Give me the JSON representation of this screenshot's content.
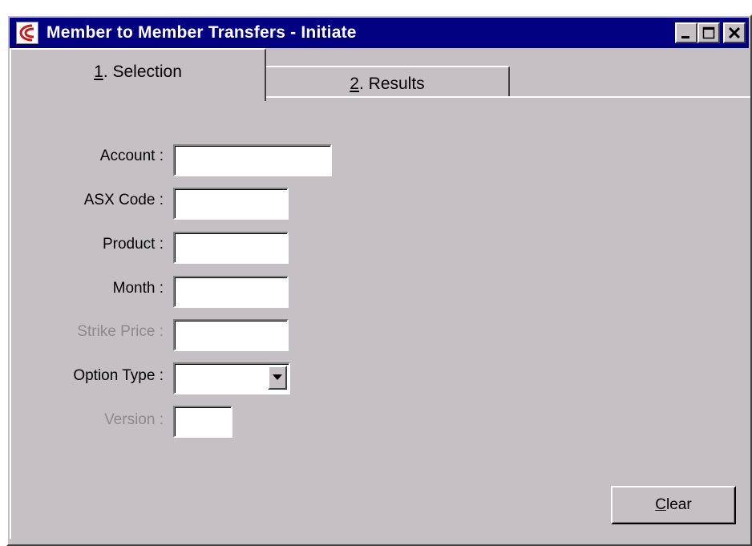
{
  "window": {
    "title": "Member to Member Transfers - Initiate",
    "app_icon": "asx-logo-icon",
    "controls": [
      "minimize-icon",
      "maximize-icon",
      "close-icon"
    ]
  },
  "tabs": [
    {
      "key": "1",
      "rest": ". Selection",
      "active": true
    },
    {
      "key": "2",
      "rest": ". Results",
      "active": false
    }
  ],
  "form": {
    "account": {
      "label": "Account :",
      "value": ""
    },
    "asx_code": {
      "label": "ASX Code :",
      "value": ""
    },
    "product": {
      "label": "Product :",
      "value": ""
    },
    "month": {
      "label": "Month :",
      "value": ""
    },
    "strike_price": {
      "label": "Strike Price :",
      "value": "",
      "disabled": true
    },
    "option_type": {
      "label": "Option Type :",
      "value": "",
      "icon": "dropdown-arrow-icon"
    },
    "version": {
      "label": "Version :",
      "value": "",
      "disabled": true
    }
  },
  "buttons": {
    "clear": {
      "key": "C",
      "rest": "lear"
    }
  },
  "colors": {
    "titlebar": "#000080",
    "face": "#c4c0c4",
    "disabled_text": "#8c8a8c",
    "logo_red": "#d01818"
  }
}
